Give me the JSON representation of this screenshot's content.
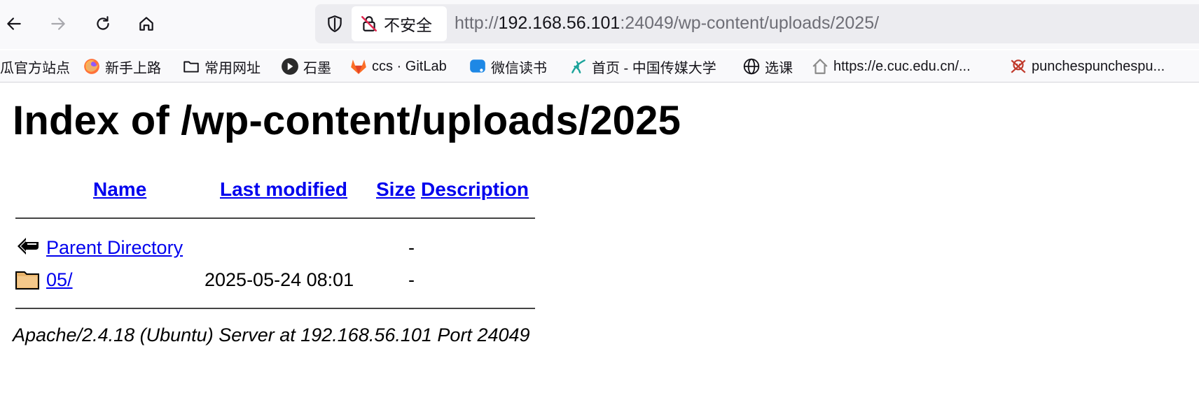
{
  "browser": {
    "security_label": "不安全",
    "url": {
      "scheme": "http://",
      "host": "192.168.56.101",
      "rest": ":24049/wp-content/uploads/2025/"
    }
  },
  "bookmarks": [
    {
      "label": "瓜官方站点",
      "icon": "firefox-icon"
    },
    {
      "label": "新手上路",
      "icon": "firefox-icon"
    },
    {
      "label": "常用网址",
      "icon": "folder-icon"
    },
    {
      "label": "石墨",
      "icon": "shimo-icon"
    },
    {
      "label": "ccs · GitLab",
      "icon": "gitlab-icon"
    },
    {
      "label": "微信读书",
      "icon": "weread-icon"
    },
    {
      "label": "首页 - 中国传媒大学",
      "icon": "cuc-icon"
    },
    {
      "label": "选课",
      "icon": "globe-icon"
    },
    {
      "label": "https://e.cuc.edu.cn/...",
      "icon": "house-icon"
    },
    {
      "label": "punchespunchespu...",
      "icon": "skull-icon"
    }
  ],
  "page": {
    "title": "Index of /wp-content/uploads/2025",
    "columns": {
      "name": "Name",
      "last_modified": "Last modified",
      "size": "Size",
      "description": "Description"
    },
    "rows": [
      {
        "name": "Parent Directory",
        "last_modified": "",
        "size": "-",
        "icon": "back-icon"
      },
      {
        "name": "05/",
        "last_modified": "2025-05-24 08:01",
        "size": "-",
        "icon": "folder-icon"
      }
    ],
    "footer": "Apache/2.4.18 (Ubuntu) Server at 192.168.56.101 Port 24049"
  }
}
